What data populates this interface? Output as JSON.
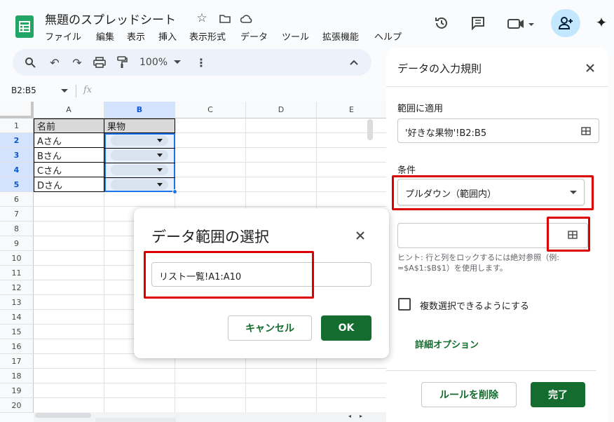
{
  "app": {
    "title": "無題のスプレッドシート"
  },
  "menus": [
    "ファイル",
    "編集",
    "表示",
    "挿入",
    "表示形式",
    "データ",
    "ツール",
    "拡張機能",
    "ヘルプ"
  ],
  "toolbar": {
    "zoom": "100%"
  },
  "formula_bar": {
    "name_box": "B2:B5",
    "fx": "fx"
  },
  "grid": {
    "columns": [
      "A",
      "B",
      "C",
      "D",
      "E"
    ],
    "rows": [
      "1",
      "2",
      "3",
      "4",
      "5",
      "6",
      "7",
      "8",
      "9",
      "10",
      "11",
      "12",
      "13",
      "14",
      "15",
      "16",
      "17",
      "18",
      "19",
      "20"
    ],
    "cells": {
      "a1": "名前",
      "b1": "果物",
      "a2": "Aさん",
      "a3": "Bさん",
      "a4": "Cさん",
      "a5": "Dさん"
    }
  },
  "panel": {
    "title": "データの入力規則",
    "range_label": "範囲に適用",
    "range_value": "'好きな果物'!B2:B5",
    "condition_label": "条件",
    "condition_value": "プルダウン（範囲内）",
    "hint": "ヒント: 行と列をロックするには絶対参照（例: =$A$1:$B$1）を使用します。",
    "multi_select": "複数選択できるようにする",
    "advanced": "詳細オプション",
    "delete": "ルールを削除",
    "done": "完了"
  },
  "dialog": {
    "title": "データ範囲の選択",
    "range_value": "リスト一覧!A1:A10",
    "cancel": "キャンセル",
    "ok": "OK"
  },
  "colors": {
    "accent": "#146c2e",
    "selection": "#1a73e8",
    "highlight": "#d00000"
  }
}
